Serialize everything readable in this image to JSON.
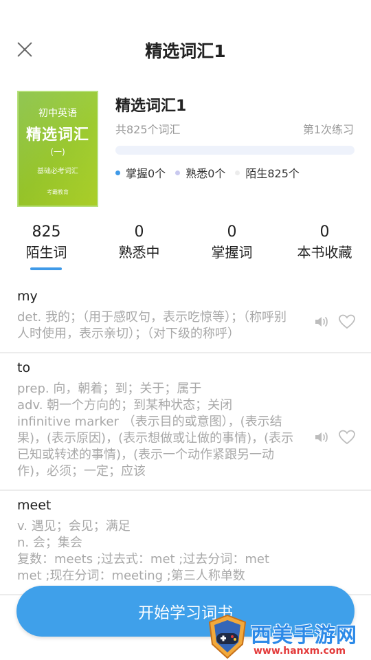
{
  "header": {
    "title": "精选词汇1"
  },
  "book": {
    "cover": {
      "subtitle": "初中英语",
      "title": "精选词汇",
      "volume": "(一)",
      "description": "基础必考词汇",
      "publisher": "考霸教育"
    },
    "name": "精选词汇1",
    "word_count": "共825个词汇",
    "practice": "第1次练习",
    "progress_fraction": 0,
    "legend": [
      {
        "label": "掌握0个",
        "color": "#3f9ae8"
      },
      {
        "label": "熟悉0个",
        "color": "#c9c9ef"
      },
      {
        "label": "陌生825个",
        "color": "#ececec"
      }
    ]
  },
  "tabs": [
    {
      "count": "825",
      "label": "陌生词"
    },
    {
      "count": "0",
      "label": "熟悉中"
    },
    {
      "count": "0",
      "label": "掌握词"
    },
    {
      "count": "0",
      "label": "本书收藏"
    }
  ],
  "words": [
    {
      "word": "my",
      "meaning": "det. 我的；（用于感叹句，表示吃惊等）；（称呼别人时使用，表示亲切）；（对下级的称呼）"
    },
    {
      "word": "to",
      "meaning": "prep. 向，朝着；到；关于；属于\nadv. 朝一个方向的；到某种状态；关闭\ninfinitive marker （表示目的或意图），(表示结果)，(表示原因)，(表示想做或让做的事情)，(表示已知或转述的事情)，(表示一个动作紧跟另一动作)，必须；一定；应该"
    },
    {
      "word": "meet",
      "meaning": "v. 遇见；会见；满足\nn. 会；集会\n复数：meets ;过去式：met ;过去分词：met\nmet ;现在分词：meeting ;第三人称单数"
    }
  ],
  "start_button": "开始学习词书",
  "watermark": {
    "name": "西美手游网",
    "url": "www.hanxm.com"
  },
  "colors": {
    "accent": "#3f9ae8",
    "cover": "#9ccc2a"
  }
}
